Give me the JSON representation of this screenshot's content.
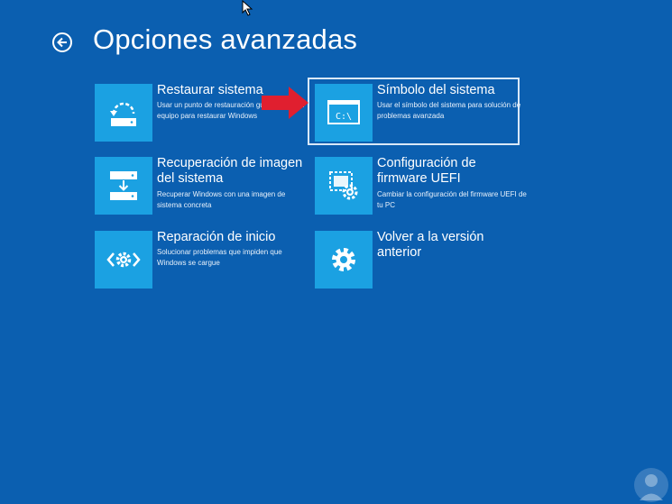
{
  "page": {
    "title": "Opciones avanzadas"
  },
  "tiles": [
    {
      "name": "Restaurar sistema",
      "desc": "Usar un punto de restauración guardado en el equipo para restaurar Windows",
      "icon": "system-restore-icon"
    },
    {
      "name": "Símbolo del sistema",
      "desc": "Usar el símbolo del sistema para solución de problemas avanzada",
      "icon": "command-prompt-icon",
      "icon_text": "C:\\"
    },
    {
      "name": "Recuperación de imagen del sistema",
      "desc": "Recuperar Windows con una imagen de sistema concreta",
      "icon": "image-recovery-icon"
    },
    {
      "name": "Configuración de firmware UEFI",
      "desc": "Cambiar la configuración del firmware UEFI de tu PC",
      "icon": "firmware-settings-icon"
    },
    {
      "name": "Reparación de inicio",
      "desc": "Solucionar problemas que impiden que Windows se cargue",
      "icon": "startup-repair-icon"
    },
    {
      "name": "Volver a la versión anterior",
      "desc": "",
      "icon": "gear-icon"
    }
  ],
  "colors": {
    "background": "#0B5FB0",
    "tile": "#1BA1E2",
    "highlight_arrow": "#E01F2F"
  }
}
